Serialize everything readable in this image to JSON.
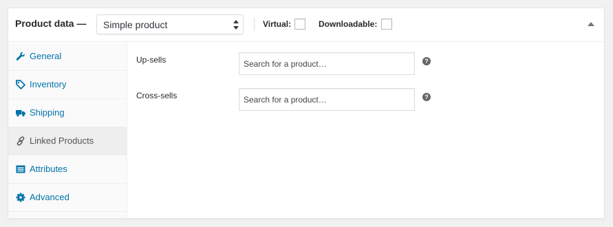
{
  "header": {
    "title": "Product data —",
    "product_type": "Simple product",
    "virtual_label": "Virtual:",
    "downloadable_label": "Downloadable:",
    "virtual_checked": false,
    "downloadable_checked": false
  },
  "tabs": [
    {
      "label": "General",
      "icon": "wrench-icon"
    },
    {
      "label": "Inventory",
      "icon": "tag-icon"
    },
    {
      "label": "Shipping",
      "icon": "truck-icon"
    },
    {
      "label": "Linked Products",
      "icon": "link-icon",
      "active": true
    },
    {
      "label": "Attributes",
      "icon": "list-icon"
    },
    {
      "label": "Advanced",
      "icon": "gear-icon"
    }
  ],
  "fields": {
    "upsells": {
      "label": "Up-sells",
      "placeholder": "Search for a product…",
      "help": "?"
    },
    "crosssells": {
      "label": "Cross-sells",
      "placeholder": "Search for a product…",
      "help": "?"
    }
  },
  "colors": {
    "link": "#0073aa",
    "active_text": "#555555",
    "help_icon": "#666666"
  }
}
